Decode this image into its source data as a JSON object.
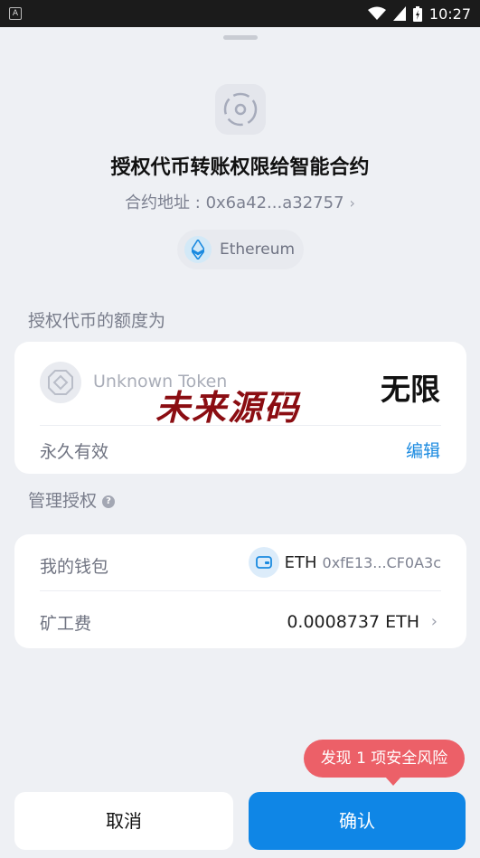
{
  "status_bar": {
    "time": "10:27",
    "app_badge": "A"
  },
  "sheet": {
    "title": "授权代币转账权限给智能合约",
    "contract_address_label": "合约地址 : 0x6a42...a32757",
    "network": "Ethereum"
  },
  "allowance_section": {
    "label": "授权代币的额度为",
    "token_name": "Unknown Token",
    "amount": "无限",
    "validity": "永久有效",
    "edit_label": "编辑"
  },
  "watermark": "未来源码",
  "manage_section": {
    "label": "管理授权",
    "wallet_label": "我的钱包",
    "wallet_chain": "ETH",
    "wallet_address": "0xfE13...CF0A3c",
    "gas_label": "矿工费",
    "gas_value": "0.0008737 ETH"
  },
  "risk_notice": "发现 1 项安全风险",
  "buttons": {
    "cancel": "取消",
    "confirm": "确认"
  },
  "colors": {
    "accent": "#0f86e6",
    "risk": "#ec6068",
    "link": "#1a8ae0",
    "watermark": "#8b0d12"
  },
  "icons": [
    "contract-icon",
    "ethereum-icon",
    "token-icon",
    "help-icon",
    "wallet-icon",
    "chevron-right-icon",
    "wifi-icon",
    "signal-icon",
    "battery-icon"
  ]
}
